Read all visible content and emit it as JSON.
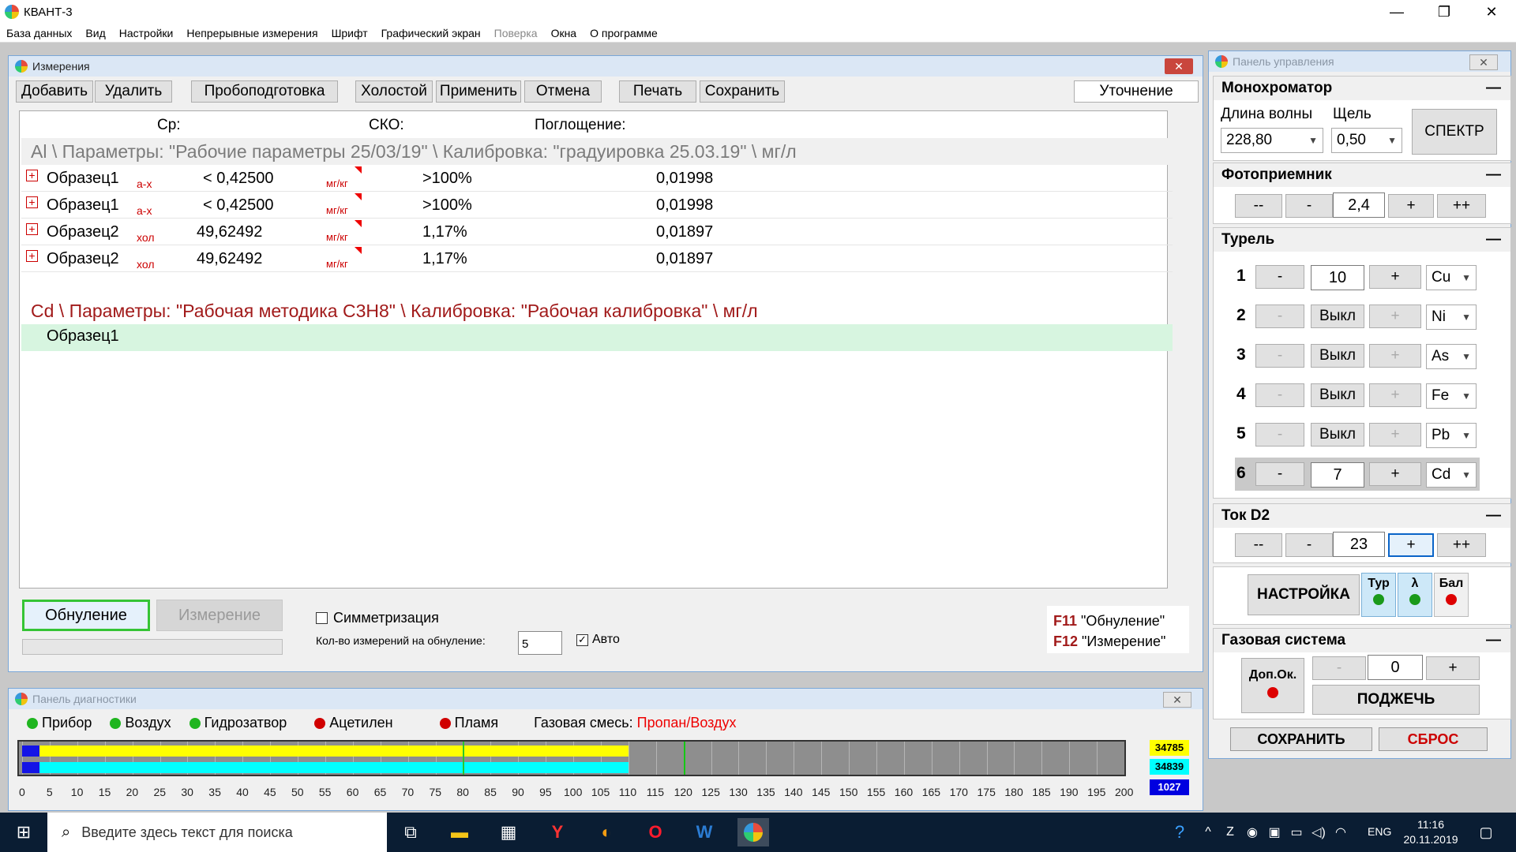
{
  "app": {
    "title": "КВАНТ-3"
  },
  "menu": [
    "База данных",
    "Вид",
    "Настройки",
    "Непрерывные измерения",
    "Шрифт",
    "Графический экран",
    "Поверка",
    "Окна",
    "О программе"
  ],
  "measure": {
    "title": "Измерения",
    "toolbar": {
      "add": "Добавить",
      "delete": "Удалить",
      "prep": "Пробоподготовка",
      "blank": "Холостой",
      "apply": "Применить",
      "cancel": "Отмена",
      "print": "Печать",
      "save": "Сохранить",
      "refine": "Уточнение"
    },
    "headers": {
      "avg": "Ср:",
      "sko": "СКО:",
      "absorb": "Поглощение:"
    },
    "group1": "Al \\ Параметры: \"Рабочие параметры 25/03/19\" \\ Калибровка: \"градуировка 25.03.19\" \\ мг/л",
    "rows": [
      {
        "name": "Образец1",
        "type": "а-х",
        "avg": "< 0,42500",
        "unit": "мг/кг",
        "sko": ">100%",
        "absorb": "0,01998"
      },
      {
        "name": "Образец1",
        "type": "а-х",
        "avg": "< 0,42500",
        "unit": "мг/кг",
        "sko": ">100%",
        "absorb": "0,01998"
      },
      {
        "name": "Образец2",
        "type": "хол",
        "avg": "49,62492",
        "unit": "мг/кг",
        "sko": "1,17%",
        "absorb": "0,01897"
      },
      {
        "name": "Образец2",
        "type": "хол",
        "avg": "49,62492",
        "unit": "мг/кг",
        "sko": "1,17%",
        "absorb": "0,01897"
      }
    ],
    "group2": "Cd \\ Параметры: \"Рабочая методика C3H8\" \\ Калибровка: \"Рабочая калибровка\" \\ мг/л",
    "group2_row": "Образец1",
    "zero_btn": "Обнуление",
    "measure_btn": "Измерение",
    "symmetry": "Симметризация",
    "count_label": "Кол-во измерений на обнуление:",
    "count_value": "5",
    "auto": "Авто",
    "hint1_key": "F11",
    "hint1_text": "\"Обнуление\"",
    "hint2_key": "F12",
    "hint2_text": "\"Измерение\""
  },
  "control": {
    "title": "Панель управления",
    "mono": {
      "title": "Монохроматор",
      "wl_label": "Длина волны",
      "slit_label": "Щель",
      "wl": "228,80",
      "slit": "0,50",
      "spectrum": "СПЕКТР"
    },
    "photo": {
      "title": "Фотоприемник",
      "value": "2,4",
      "mm": "--",
      "m": "-",
      "p": "+",
      "pp": "++"
    },
    "turret": {
      "title": "Турель",
      "rows": [
        {
          "n": "1",
          "val": "10",
          "el": "Cu"
        },
        {
          "n": "2",
          "val": "Выкл",
          "el": "Ni"
        },
        {
          "n": "3",
          "val": "Выкл",
          "el": "As"
        },
        {
          "n": "4",
          "val": "Выкл",
          "el": "Fe"
        },
        {
          "n": "5",
          "val": "Выкл",
          "el": "Pb"
        },
        {
          "n": "6",
          "val": "7",
          "el": "Cd"
        }
      ]
    },
    "d2": {
      "title": "Ток D2",
      "value": "23"
    },
    "setup": "НАСТРОЙКА",
    "ind": [
      "Тур",
      "λ",
      "Бал"
    ],
    "gas": {
      "title": "Газовая система",
      "extra": "Доп.Ок.",
      "value": "0",
      "ignite": "ПОДЖЕЧЬ"
    },
    "save": "СОХРАНИТЬ",
    "reset": "СБРОС"
  },
  "diag": {
    "title": "Панель диагностики",
    "items": [
      {
        "label": "Прибор",
        "color": "#1fb51f"
      },
      {
        "label": "Воздух",
        "color": "#1fb51f"
      },
      {
        "label": "Гидрозатвор",
        "color": "#1fb51f"
      },
      {
        "label": "Ацетилен",
        "color": "#d00000"
      },
      {
        "label": "Пламя",
        "color": "#d00000"
      }
    ],
    "gas_label": "Газовая смесь:",
    "gas_value": "Пропан/Воздух",
    "ticks": [
      "0",
      "5",
      "10",
      "15",
      "20",
      "25",
      "30",
      "35",
      "40",
      "45",
      "50",
      "55",
      "60",
      "65",
      "70",
      "75",
      "80",
      "85",
      "90",
      "95",
      "100",
      "105",
      "110",
      "115",
      "120",
      "125",
      "130",
      "135",
      "140",
      "145",
      "150",
      "155",
      "160",
      "165",
      "170",
      "175",
      "180",
      "185",
      "190",
      "195",
      "200"
    ],
    "bar1_level": 110,
    "bar2_level": 110,
    "marker1": 80,
    "marker2": 120,
    "val1": "34785",
    "val2": "34839",
    "val3": "1027"
  },
  "taskbar": {
    "search": "Введите здесь текст для поиска",
    "lang": "ENG",
    "time": "11:16",
    "date": "20.11.2019"
  }
}
